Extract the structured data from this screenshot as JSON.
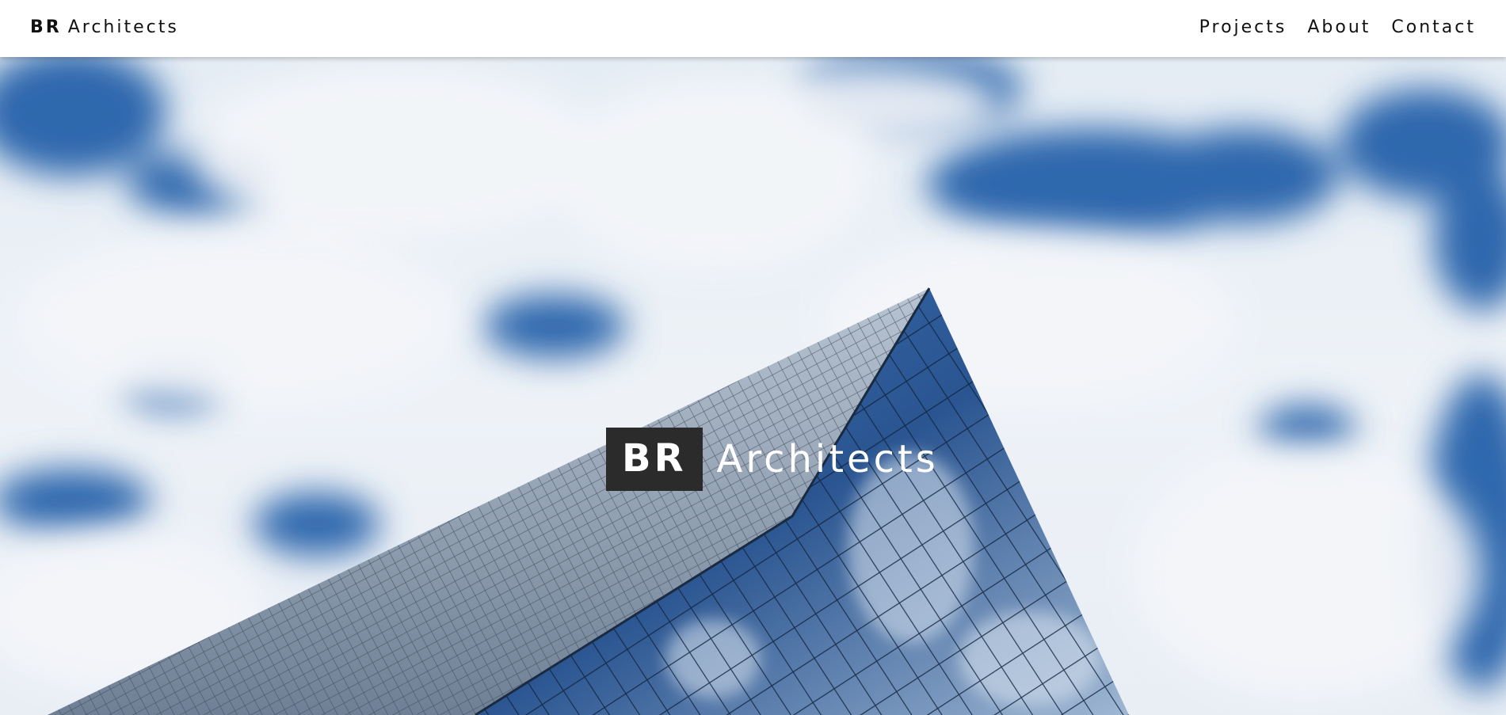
{
  "header": {
    "brand_bold": "BR",
    "brand_text": "Architects"
  },
  "nav": {
    "items": [
      {
        "label": "Projects"
      },
      {
        "label": "About"
      },
      {
        "label": "Contact"
      }
    ]
  },
  "hero": {
    "title_bold": "BR",
    "title_text": "Architects",
    "image_subject": "glass-skyscraper-against-cloudy-sky"
  },
  "colors": {
    "topbar_bg": "#ffffff",
    "text": "#111111",
    "badge_bg": "#2b2b2b",
    "sky_blue": "#2f67ad",
    "glass_dark": "#1c3d6b"
  }
}
